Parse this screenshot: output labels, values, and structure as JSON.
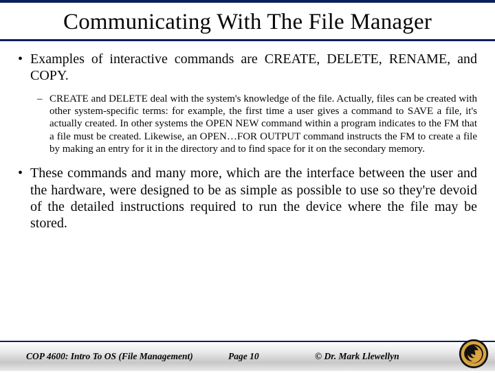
{
  "title": "Communicating With The File Manager",
  "bullets": [
    {
      "level": 1,
      "text": "Examples of interactive commands are CREATE, DELETE, RENAME, and COPY."
    },
    {
      "level": 2,
      "text": "CREATE and DELETE deal with the system's knowledge of the file.  Actually, files can be created with other system-specific terms: for example, the first time a user gives a command to SAVE a file, it's actually created.  In other systems the OPEN NEW command within a program indicates to the FM that a file must be created.  Likewise, an OPEN…FOR OUTPUT command instructs the FM to create a file by making an entry for it in the directory and to find space for it on the secondary memory."
    },
    {
      "level": 1,
      "text": "These commands and many more, which are the interface between the user and the hardware, were designed to be as simple as possible to use so they're devoid of the detailed instructions required to run the device where the file may be stored."
    }
  ],
  "footer": {
    "course": "COP 4600: Intro To OS  (File Management)",
    "page": "Page 10",
    "author": "© Dr. Mark Llewellyn"
  },
  "icons": {
    "logo": "ucf-pegasus-logo"
  },
  "colors": {
    "accent": "#0b1f5b",
    "logo_gold": "#d9a441"
  }
}
